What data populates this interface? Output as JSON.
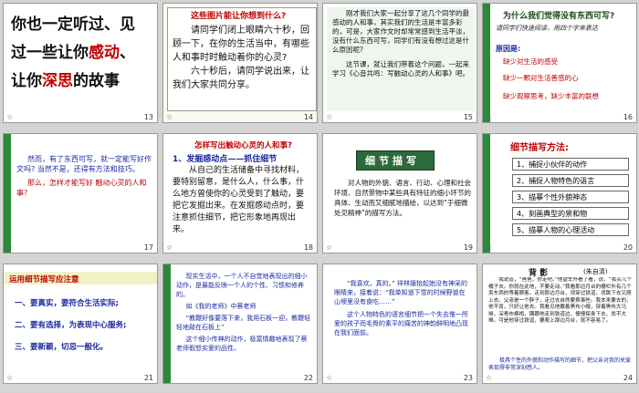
{
  "slides": [
    {
      "num": "13",
      "lines": [
        "你也一定听过、见",
        "过一些让你感动、",
        "让你深思的故事"
      ]
    },
    {
      "num": "14",
      "title": "这些图片能让你想到什么?",
      "body": "请同学们闭上眼睛六十秒，回顾一下，在你的生活当中，有哪些人和事时时触动着你的心灵?",
      "body2": "六十秒后，请同学说出来，让我们大家共同分享。"
    },
    {
      "num": "15",
      "body": "刚才我们大家一起分享了这几个同学的最感动的人和事，其实我们的生活是丰富多彩的，可是，大家作文时却常常感到生活平淡，没有什么东西可写，同学们有没有想过这是什么原因呢?",
      "body2": "这节课，就让我们带着这个问题，一起来学习《心音共鸣：写触动心灵的人和事》吧。"
    },
    {
      "num": "16",
      "title": "为什么我们觉得没有东西可写?",
      "body": "请同学们快速阅读，用四个字来表达",
      "sub": "原因是:",
      "r1": "缺少对生活的感受",
      "r2": "缺少一颗对生活善感的心",
      "r3": "缺少观察思考，缺少丰富的联想"
    },
    {
      "num": "17",
      "body": "然而，有了东西可写，就一定能写好作文吗? 当然不是，还得有方法和技巧。",
      "body2": "那么，怎样才能写好 触动心灵的人和事?"
    },
    {
      "num": "18",
      "title": "怎样写出触动心灵的人和事?",
      "h": "1、发掘感动点——抓住细节",
      "body": "从自己的生活储备中寻找材料，要特别留意，是什么人，什么事，什么地方曾使你的心灵受到了触动，要把它发掘出来。在发掘感动点时，要注意抓住细节，把它形象地再现出来。"
    },
    {
      "num": "19",
      "title": "细节描写",
      "body": "对人物的外貌、语言、行动、心理和社会环境、自然景物中某些具有特征的细小环节的具体、生动而又细腻地描绘，以达到“于细微处见精神”的描写方法。"
    },
    {
      "num": "20",
      "title": "细节描写方法:",
      "items": [
        "1、捕捉小伙伴的动作",
        "2、捕捉人物特色的语言",
        "3、描摹个性外貌神态",
        "4、刻画典型的景和物",
        "5、描摹人物的心理活动"
      ]
    },
    {
      "num": "21",
      "title": "运用细节描写应注意",
      "items": [
        "一、要真实，要符合生活实际;",
        "二、要有选择，为表现中心服务;",
        "三、要新颖，切忌一般化。"
      ]
    },
    {
      "num": "22",
      "body": "现实生活中，一个人不自觉地表现出的细小动作，是最能反映一个人的个性、习惯和修养的。",
      "ex": "如《我的老师》中蔡老师",
      "quote": "“教鞭好像要落下来，我用石板一迎，教鞭轻轻地敲在石板上”",
      "body2": "这个细小传神的动作，极富情趣地表现了蔡老师假怒实爱的品性。"
    },
    {
      "num": "23",
      "body": "“我喜欢，真的。” 祥林嫂抬起她没有神采的眼睛来，接着说：“我单知道下雪的时候野兽在山墺里没有食吃……”",
      "body2": "这个人物特色的语言细节把一个失去惟一所爱的孩子而毛骨的素平的痛苦的神韵鲜明地凸现在我们面前。"
    },
    {
      "num": "24",
      "title": "背  影",
      "author": "(朱自清)",
      "body": "我说道，“爸爸，你走吧。”他望车外看了看，说，“我买几个橘子去。你就在此地，不要走动。”我看那边月台的栅栏外有几个卖东西的等着顾客。走到那边月台，须穿过铁道，须跳下去又爬上去。父亲是一个胖子，走过去自然要费事些。我本来要去的，他不肯，只好让他去。我看见他戴着黑布小帽，穿着黑布大马褂，深青布棉袍，蹒跚地走到铁道边，慢慢探身下去，尚不大难。可是他穿过铁道，要爬上那边月台，就不容易了。",
      "tail": "极具个性的外貌和动作描写的细节，把父亲对我的关爱表现得非常深刻感人。"
    }
  ],
  "star": "☆"
}
